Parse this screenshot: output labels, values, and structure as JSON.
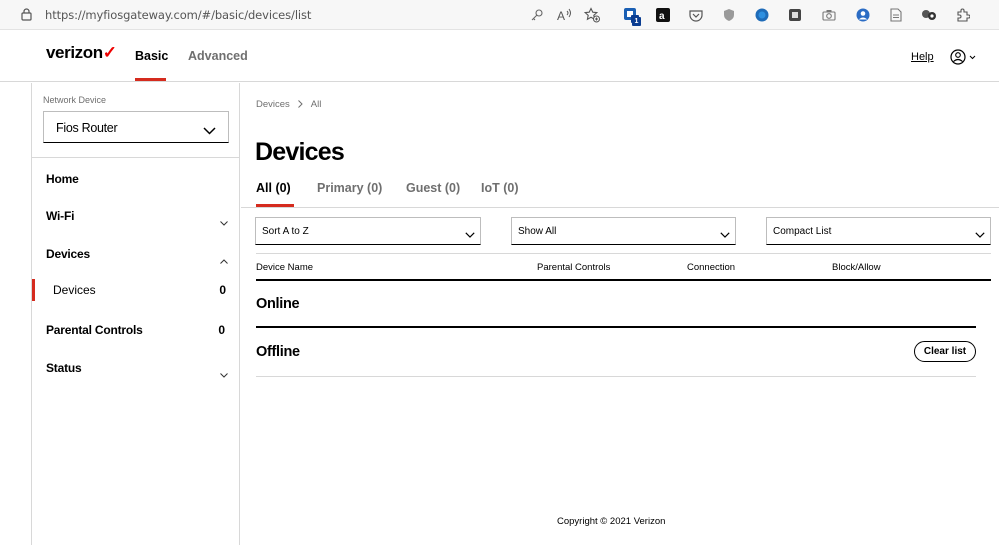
{
  "browser": {
    "url": "https://myfiosgateway.com/#/basic/devices/list",
    "toolbar_icons": [
      "key-icon",
      "read-aloud-icon",
      "favorites-icon",
      "extension-badge-icon",
      "extension-a-icon",
      "pocket-icon",
      "shield-extension-icon",
      "globe-extension-icon",
      "extension-square-icon",
      "camera-icon",
      "profile-extension-icon",
      "document-icon",
      "extension-link-icon",
      "extensions-puzzle-icon"
    ],
    "extension_badge": "1"
  },
  "header": {
    "logo": "verizon",
    "logo_mark": "✓",
    "tabs": [
      "Basic",
      "Advanced"
    ],
    "help_label": "Help",
    "accent_color": "#d52b1e"
  },
  "sidebar": {
    "network_device_label": "Network Device",
    "network_device_value": "Fios Router",
    "items": [
      {
        "label": "Home"
      },
      {
        "label": "Wi-Fi"
      },
      {
        "label": "Devices"
      },
      {
        "label": "Devices",
        "count": "0"
      },
      {
        "label": "Parental Controls",
        "count": "0"
      },
      {
        "label": "Status"
      }
    ]
  },
  "main": {
    "breadcrumb": [
      "Devices",
      "All"
    ],
    "title": "Devices",
    "tabs": [
      "All (0)",
      "Primary (0)",
      "Guest (0)",
      "IoT (0)"
    ],
    "dropdowns": [
      "Sort A to Z",
      "Show All",
      "Compact List"
    ],
    "columns": [
      "Device Name",
      "Parental Controls",
      "Connection",
      "Block/Allow"
    ],
    "groups": {
      "online": "Online",
      "offline": "Offline"
    },
    "clear_button": "Clear list"
  },
  "footer": {
    "copyright": "Copyright © 2021 Verizon"
  }
}
